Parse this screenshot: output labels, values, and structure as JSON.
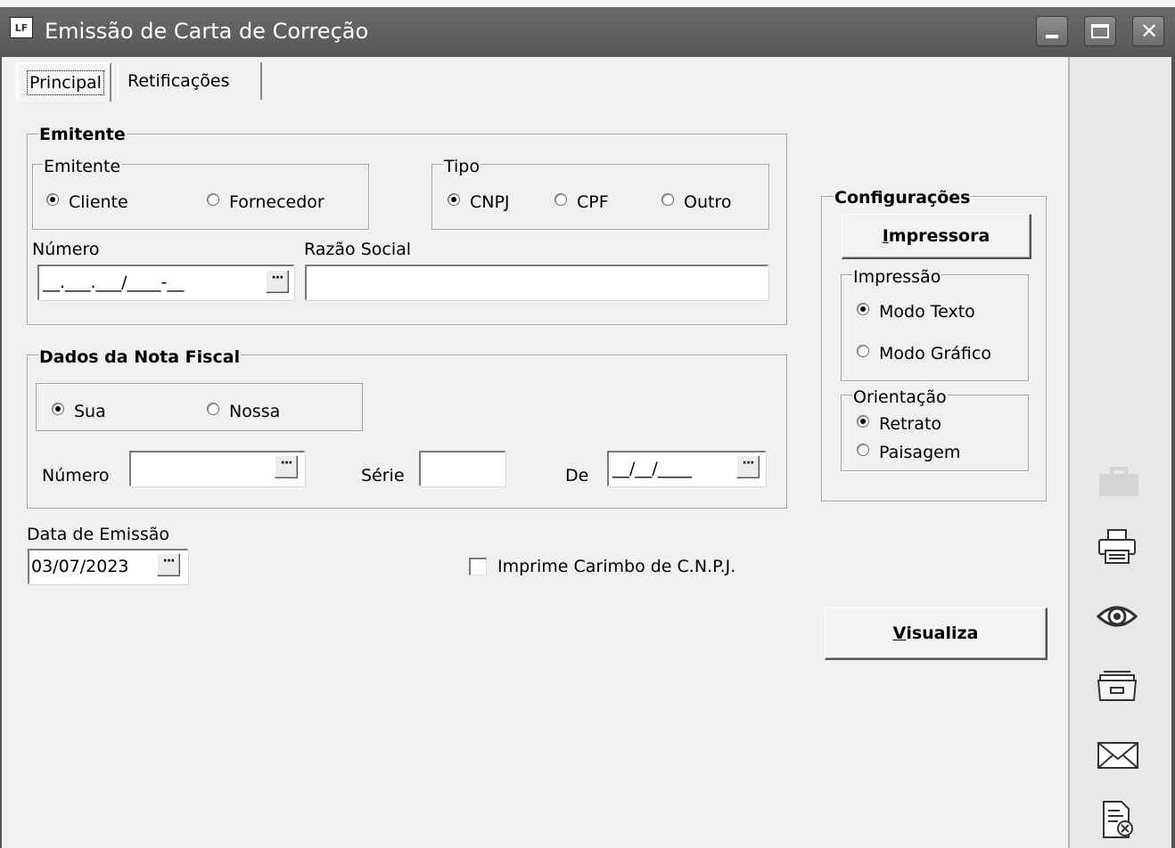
{
  "window": {
    "title": "Emissão de Carta de Correção",
    "icon_label": "LF",
    "controls": [
      "minimize-icon",
      "maximize-icon",
      "close-icon"
    ]
  },
  "tabs": [
    {
      "label": "Principal",
      "selected": true
    },
    {
      "label": "Retificações",
      "selected": false
    }
  ],
  "emitente": {
    "title": "Emitente",
    "subgroup_title": "Emitente",
    "options": [
      {
        "label": "Cliente",
        "checked": true
      },
      {
        "label": "Fornecedor",
        "checked": false
      }
    ],
    "tipo": {
      "title": "Tipo",
      "options": [
        {
          "label": "CNPJ",
          "checked": true
        },
        {
          "label": "CPF",
          "checked": false
        },
        {
          "label": "Outro",
          "checked": false
        }
      ]
    },
    "numero_label": "Número",
    "numero_mask": "__.___.___/____-__",
    "razao_social_label": "Razão Social",
    "razao_social_value": ""
  },
  "nota": {
    "title": "Dados da Nota Fiscal",
    "options": [
      {
        "label": "Sua",
        "checked": true
      },
      {
        "label": "Nossa",
        "checked": false
      }
    ],
    "numero_label": "Número",
    "numero_value": "",
    "serie_label": "Série",
    "serie_value": "",
    "de_label": "De",
    "de_mask": "__/__/____"
  },
  "emissao": {
    "label": "Data de Emissão",
    "value": "03/07/2023"
  },
  "carimbo": {
    "label": "Imprime Carimbo de C.N.P.J.",
    "checked": false
  },
  "config": {
    "title": "Configurações",
    "printer_button": {
      "underlined": "I",
      "rest": "mpressora"
    },
    "impressao": {
      "title": "Impressão",
      "options": [
        {
          "label": "Modo Texto",
          "checked": true
        },
        {
          "label": "Modo Gráfico",
          "checked": false
        }
      ]
    },
    "orientacao": {
      "title": "Orientação",
      "options": [
        {
          "label": "Retrato",
          "checked": true
        },
        {
          "label": "Paisagem",
          "checked": false
        }
      ]
    }
  },
  "visualiza_button": {
    "underlined": "V",
    "rest": "isualiza"
  },
  "ellipsis": "···",
  "sidebar_icons": [
    "briefcase-icon",
    "printer-icon",
    "eye-icon",
    "folder-icon",
    "envelope-icon",
    "cancel-document-icon"
  ]
}
